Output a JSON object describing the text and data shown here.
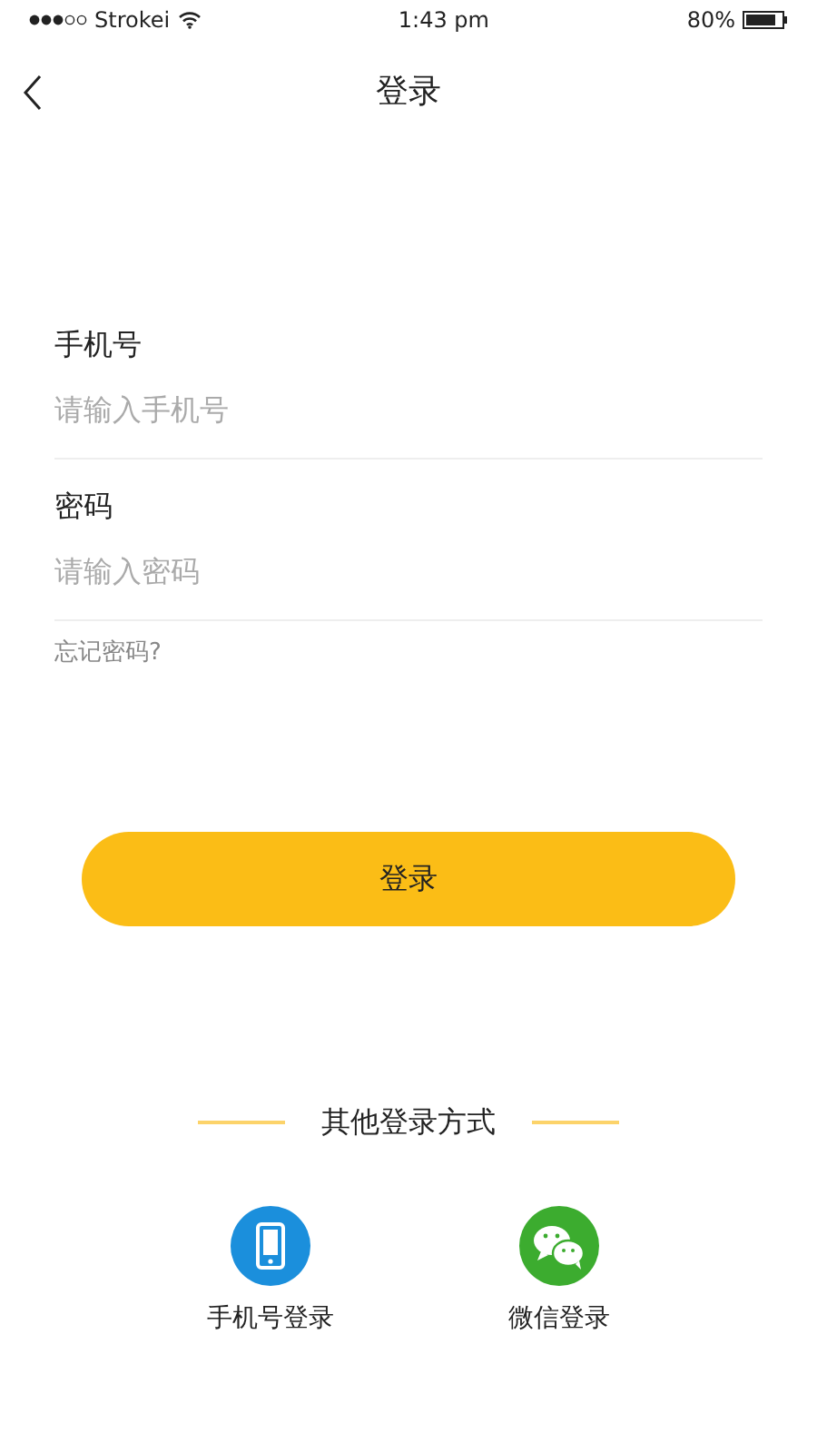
{
  "status_bar": {
    "carrier": "Strokei",
    "time": "1:43 pm",
    "battery": "80%"
  },
  "nav": {
    "title": "登录"
  },
  "fields": [
    {
      "label": "手机号",
      "placeholder": "请输入手机号"
    },
    {
      "label": "密码",
      "placeholder": "请输入密码"
    }
  ],
  "forgot_link": "忘记密码?",
  "login_button": "登录",
  "other_heading": "其他登录方式",
  "methods": [
    {
      "kind": "phone",
      "label": "手机号登录"
    },
    {
      "kind": "wechat",
      "label": "微信登录"
    }
  ]
}
